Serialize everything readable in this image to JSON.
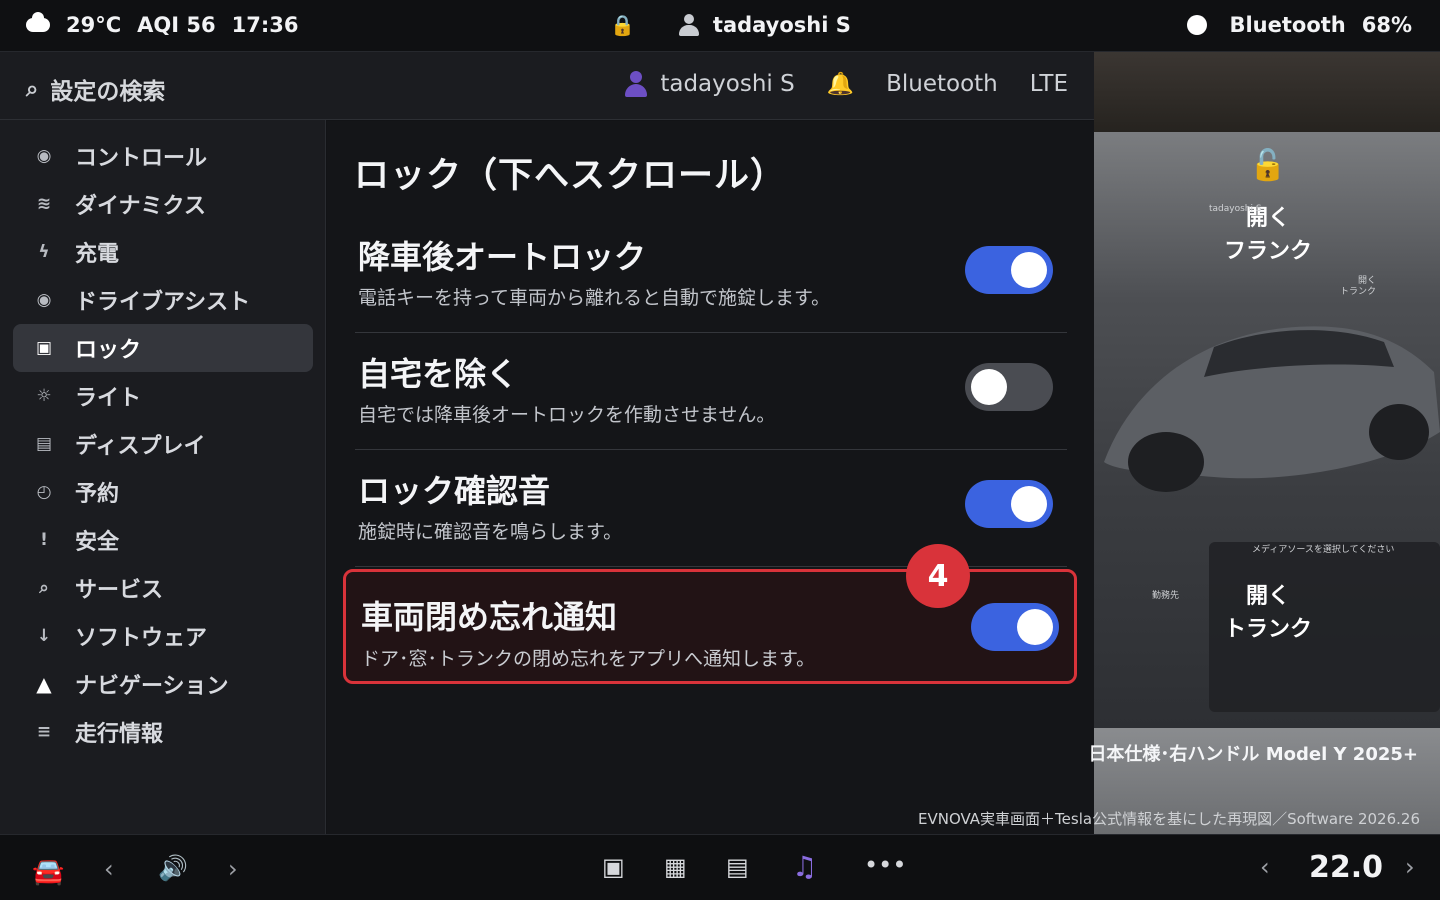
{
  "status_bar": {
    "weather": "29°C",
    "aqi": "AQI 56",
    "time": "17:36",
    "user": "tadayoshi S",
    "bluetooth": "Bluetooth",
    "battery": "68%"
  },
  "header": {
    "search_placeholder": "設定の検索",
    "user": "tadayoshi S",
    "bluetooth": "Bluetooth",
    "network": "LTE"
  },
  "sidebar": {
    "items": [
      {
        "label": "コントロール",
        "icon": "circle-icon"
      },
      {
        "label": "ダイナミクス",
        "icon": "wave-icon"
      },
      {
        "label": "充電",
        "icon": "bolt-icon"
      },
      {
        "label": "ドライブアシスト",
        "icon": "circle-icon"
      },
      {
        "label": "ロック",
        "icon": "square-icon",
        "active": true
      },
      {
        "label": "ライト",
        "icon": "sun-icon"
      },
      {
        "label": "ディスプレイ",
        "icon": "display-icon"
      },
      {
        "label": "予約",
        "icon": "clock-icon"
      },
      {
        "label": "安全",
        "icon": "exclamation-icon"
      },
      {
        "label": "サービス",
        "icon": "wrench-icon"
      },
      {
        "label": "ソフトウェア",
        "icon": "download-icon"
      },
      {
        "label": "ナビゲーション",
        "icon": "triangle-icon"
      },
      {
        "label": "走行情報",
        "icon": "list-icon"
      }
    ]
  },
  "main": {
    "section_title": "ロック（下へスクロール）",
    "settings": [
      {
        "title": "降車後オートロック",
        "desc": "電話キーを持って車両から離れると自動で施錠します。",
        "on": true
      },
      {
        "title": "自宅を除く",
        "desc": "自宅では降車後オートロックを作動させません。",
        "on": false
      },
      {
        "title": "ロック確認音",
        "desc": "施錠時に確認音を鳴らします。",
        "on": true
      },
      {
        "title": "車両閉め忘れ通知",
        "desc": "ドア･窓･トランクの閉め忘れをアプリへ通知します。",
        "on": true
      }
    ],
    "step_badge": "4"
  },
  "car_panel": {
    "frunk_label_1": "開く",
    "frunk_label_2": "フランク",
    "trunk_label_1": "開く",
    "trunk_label_2": "トランク",
    "tiny_user": "tadayoshi S",
    "tiny_trunk_1": "開く",
    "tiny_trunk_2": "トランク",
    "tiny_media": "メディアソースを選択してください",
    "tiny_dest": "勤務先",
    "caption_model": "日本仕様･右ハンドル Model Y 2025+",
    "caption_source": "EVNOVA実車画面＋Tesla公式情報を基にした再現図／Software 2026.26"
  },
  "bottom_bar": {
    "temperature": "22.0"
  },
  "colors": {
    "accent_toggle": "#3b63e0",
    "highlight_border": "#d9333a",
    "lock_icon": "#f0a020"
  }
}
